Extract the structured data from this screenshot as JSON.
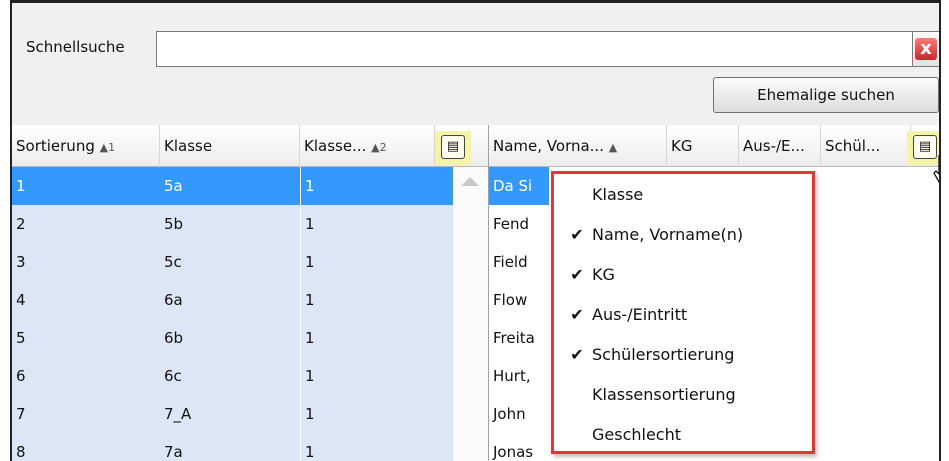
{
  "search": {
    "label": "Schnellsuche",
    "value": "",
    "clear_icon": "x"
  },
  "buttons": {
    "ehemalige": "Ehemalige suchen"
  },
  "left_grid": {
    "columns": [
      {
        "label": "Sortierung",
        "sort": "▲1"
      },
      {
        "label": "Klasse",
        "sort": ""
      },
      {
        "label": "Klasse...",
        "sort": "▲2"
      }
    ],
    "column_chooser_icon": "▤",
    "rows": [
      [
        "1",
        "5a",
        "1"
      ],
      [
        "2",
        "5b",
        "1"
      ],
      [
        "3",
        "5c",
        "1"
      ],
      [
        "4",
        "6a",
        "1"
      ],
      [
        "5",
        "6b",
        "1"
      ],
      [
        "6",
        "6c",
        "1"
      ],
      [
        "7",
        "7_A",
        "1"
      ],
      [
        "8",
        "7a",
        "1"
      ]
    ]
  },
  "right_grid": {
    "columns": [
      {
        "label": "Name, Vorna...",
        "sort": "▲"
      },
      {
        "label": "KG",
        "sort": ""
      },
      {
        "label": "Aus-/E...",
        "sort": ""
      },
      {
        "label": "Schül...",
        "sort": ""
      }
    ],
    "column_chooser_icon": "▤",
    "rows": [
      "Da Si",
      "Fend",
      "Field",
      "Flow",
      "Freita",
      "Hurt,",
      "John",
      "Jonas"
    ]
  },
  "column_menu": {
    "check_glyph": "✔",
    "items": [
      {
        "label": "Klasse",
        "checked": ""
      },
      {
        "label": "Name, Vorname(n)",
        "checked": "✔"
      },
      {
        "label": "KG",
        "checked": "✔"
      },
      {
        "label": "Aus-/Eintritt",
        "checked": "✔"
      },
      {
        "label": "Schülersortierung",
        "checked": "✔"
      },
      {
        "label": "Klassensortierung",
        "checked": ""
      },
      {
        "label": "Geschlecht",
        "checked": ""
      }
    ]
  },
  "colors": {
    "selection": "#3399ff",
    "row_highlight": "#dce6f6",
    "menu_border": "#e0393c",
    "highlight_yellow": "#f4f4a8"
  }
}
